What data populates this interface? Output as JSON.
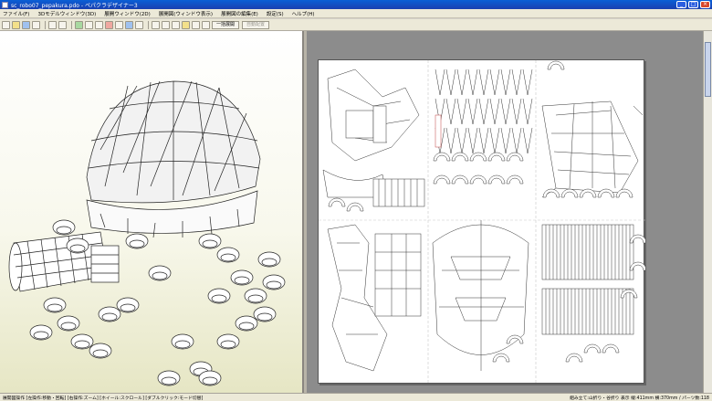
{
  "titlebar": {
    "title": "sc_robo07_pepakura.pdo - ペパクラデザイナー3",
    "minimize_glyph": "_",
    "maximize_glyph": "□",
    "close_glyph": "×"
  },
  "menu": [
    "ファイル(F)",
    "3Dモデルウィンドウ(3D)",
    "展開ウィンドウ(2D)",
    "展開図(ウィンドウ表示)",
    "展開図の編集(E)",
    "設定(S)",
    "ヘルプ(H)"
  ],
  "toolbar": {
    "button_text_1": "一括展開",
    "button_text_2": "自動配置"
  },
  "status": {
    "left": "展開図操作 [左操作:移動・回転] [右操作:ズーム] [ホイール:スクロール] [ダブルクリック:モード切替]",
    "right": "組み立て:山折り・谷折り 表示 縦:411mm 横:370mm / パーツ数:118"
  },
  "colors": {
    "titlebar": "#1a4fd0",
    "workspace_2d": "#8c8c8c",
    "view_3d_bg": "#f8f8ec",
    "highlight_part": "#c04040"
  }
}
